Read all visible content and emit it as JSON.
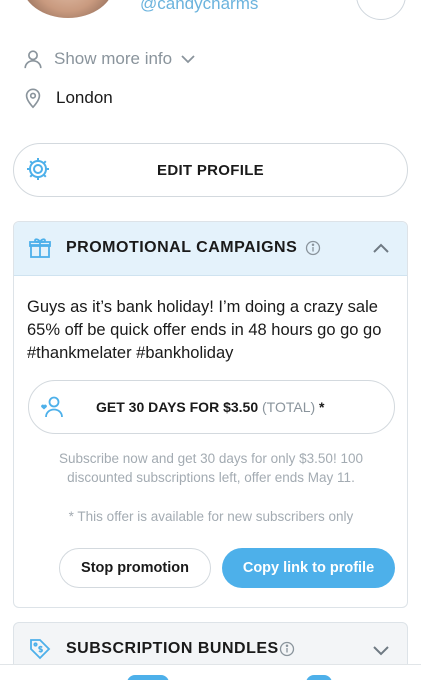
{
  "profile": {
    "username": "@candycharms",
    "show_more_label": "Show more info",
    "location": "London",
    "edit_profile_label": "EDIT PROFILE"
  },
  "promo": {
    "title": "PROMOTIONAL CAMPAIGNS",
    "description": "Guys as it’s bank holiday! I’m doing a crazy sale 65% off be quick offer ends in 48 hours go go go #thankmelater #bankholiday",
    "offer_label": "GET 30 DAYS FOR $3.50",
    "offer_total": "(TOTAL)",
    "offer_suffix": "*",
    "note": "Subscribe now and get 30 days for only $3.50! 100 discounted subscriptions left, offer ends May 11.",
    "note_small": "* This offer is available for new subscribers only",
    "stop_label": "Stop promotion",
    "copy_label": "Copy link to profile"
  },
  "bundles": {
    "title": "SUBSCRIPTION BUNDLES"
  },
  "colors": {
    "accent": "#4db0ea",
    "header_bg": "#e4f2fb",
    "muted_text": "#a3abb2"
  },
  "icons": {
    "user": "user-icon",
    "chevron": "chevron-down-icon",
    "location": "location-pin-icon",
    "gear": "gear-icon",
    "gift": "gift-icon",
    "info": "info-icon",
    "collapse": "chevron-up-icon",
    "subscribers": "user-heart-icon",
    "tag": "dollar-tag-icon"
  }
}
